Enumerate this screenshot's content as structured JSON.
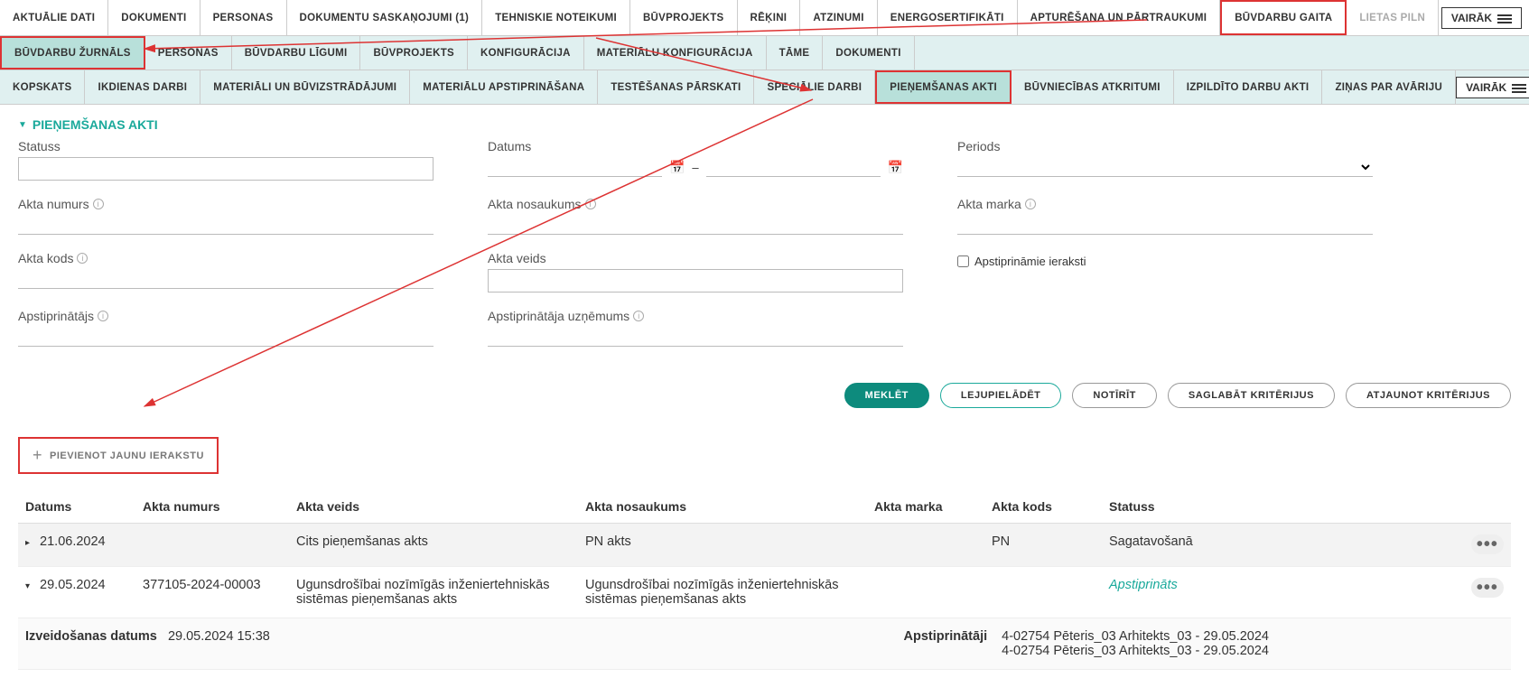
{
  "nav1": [
    "AKTUĀLIE DATI",
    "DOKUMENTI",
    "PERSONAS",
    "DOKUMENTU SASKAŅOJUMI (1)",
    "TEHNISKIE NOTEIKUMI",
    "BŪVPROJEKTS",
    "RĒĶINI",
    "ATZINUMI",
    "ENERGOSERTIFIKĀTI",
    "APTURĒŠANA UN PĀRTRAUKUMI",
    "BŪVDARBU GAITA",
    "LIETAS PILN"
  ],
  "nav2": [
    "BŪVDARBU ŽURNĀLS",
    "PERSONAS",
    "BŪVDARBU LĪGUMI",
    "BŪVPROJEKTS",
    "KONFIGURĀCIJA",
    "MATERIĀLU KONFIGURĀCIJA",
    "TĀME",
    "DOKUMENTI"
  ],
  "nav3": [
    "KOPSKATS",
    "IKDIENAS DARBI",
    "MATERIĀLI UN BŪVIZSTRĀDĀJUMI",
    "MATERIĀLU APSTIPRINĀŠANA",
    "TESTĒŠANAS PĀRSKATI",
    "SPECIĀLIE DARBI",
    "PIEŅEMŠANAS AKTI",
    "BŪVNIECĪBAS ATKRITUMI",
    "IZPILDĪTO DARBU AKTI",
    "ZIŅAS PAR AVĀRIJU"
  ],
  "vairak": "VAIRĀK",
  "section": "PIEŅEMŠANAS AKTI",
  "filters": {
    "status": "Statuss",
    "datums": "Datums",
    "periods": "Periods",
    "akta_numurs": "Akta numurs",
    "akta_nosaukums": "Akta nosaukums",
    "akta_marka": "Akta marka",
    "akta_kods": "Akta kods",
    "akta_veids": "Akta veids",
    "apstip_ieraksti": "Apstiprināmie ieraksti",
    "apstiprinatajs": "Apstiprinātājs",
    "apstip_uzn": "Apstiprinātāja uzņēmums"
  },
  "buttons": {
    "meklet": "MEKLĒT",
    "lejupieladet": "LEJUPIELĀDĒT",
    "notirit": "NOTĪRĪT",
    "saglabat": "SAGLABĀT KRITĒRIJUS",
    "atjaunot": "ATJAUNOT KRITĒRIJUS",
    "pievienot": "PIEVIENOT JAUNU IERAKSTU"
  },
  "table": {
    "headers": [
      "Datums",
      "Akta numurs",
      "Akta veids",
      "Akta nosaukums",
      "Akta marka",
      "Akta kods",
      "Statuss"
    ],
    "rows": [
      {
        "exp": "▸",
        "datums": "21.06.2024",
        "numurs": "",
        "veids": "Cits pieņemšanas akts",
        "nosaukums": "PN akts",
        "marka": "",
        "kods": "PN",
        "statuss": "Sagatavošanā",
        "green": false
      },
      {
        "exp": "▾",
        "datums": "29.05.2024",
        "numurs": "377105-2024-00003",
        "veids": "Ugunsdrošībai nozīmīgās inženiertehniskās sistēmas pieņemšanas akts",
        "nosaukums": "Ugunsdrošībai nozīmīgās inženiertehniskās sistēmas pieņemšanas akts",
        "marka": "",
        "kods": "",
        "statuss": "Apstiprināts",
        "green": true
      }
    ],
    "detail": {
      "izv_label": "Izveidošanas datums",
      "izv_val": "29.05.2024 15:38",
      "apst_label": "Apstiprinātāji",
      "apst_val1": "4-02754 Pēteris_03 Arhitekts_03 - 29.05.2024",
      "apst_val2": "4-02754 Pēteris_03 Arhitekts_03 - 29.05.2024"
    }
  }
}
